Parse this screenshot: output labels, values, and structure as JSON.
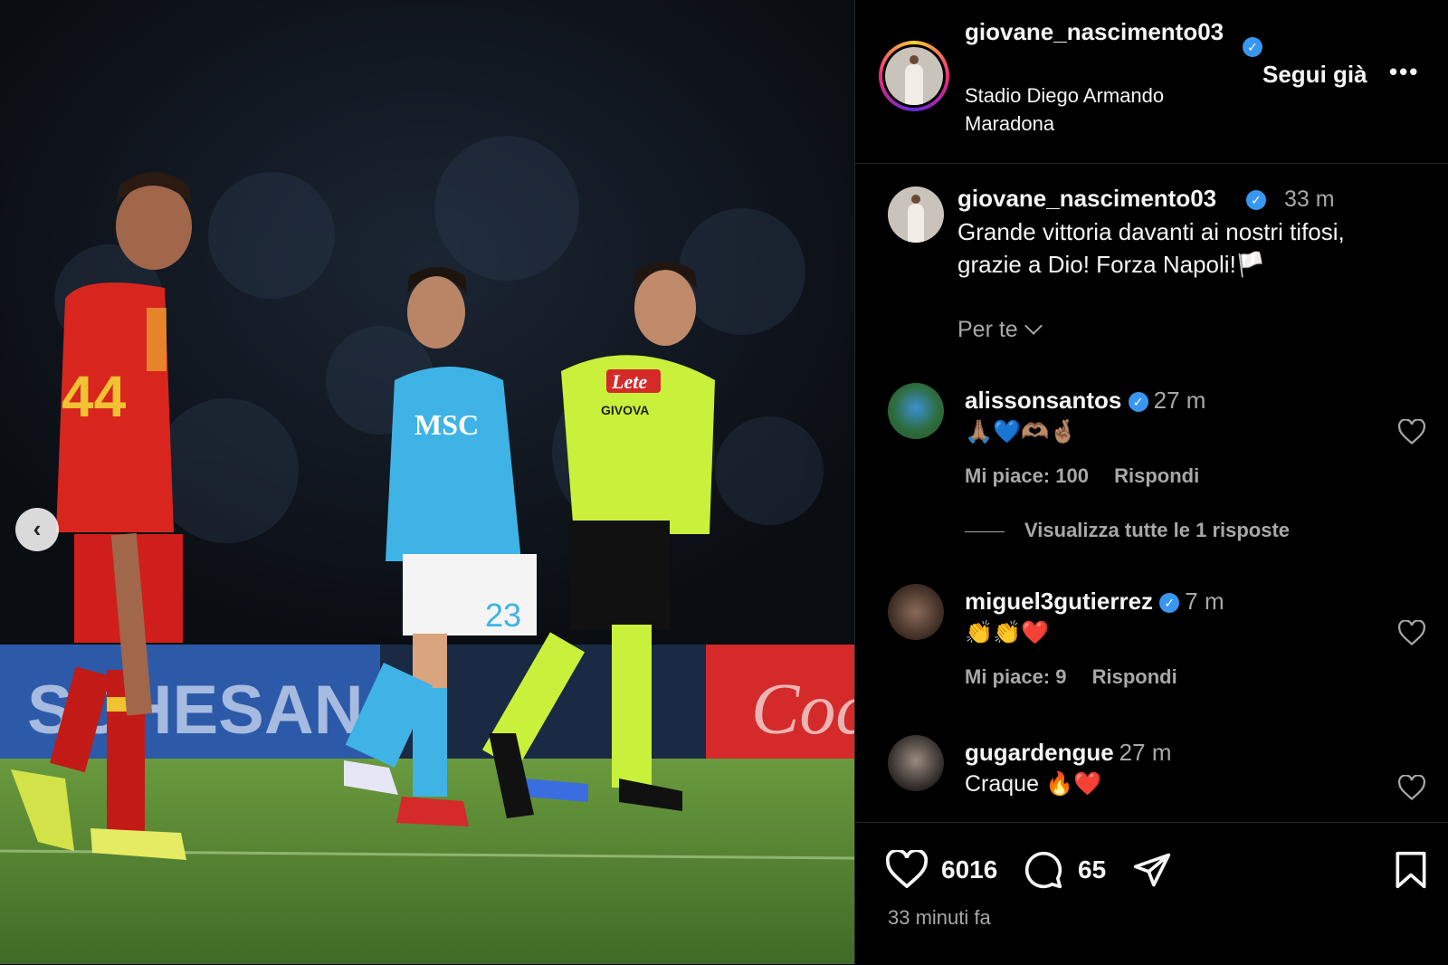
{
  "post": {
    "username": "giovane_nascimento03",
    "username_wrapped": "giovane_nascimento03",
    "location": "Stadio Diego Armando Maradona",
    "follow_label": "Segui già",
    "more_label": "•••",
    "verified_glyph": "✓"
  },
  "photo": {
    "prev_glyph": "‹",
    "banner_left": "SCHESANA",
    "banner_right": "Coca",
    "shirt_sponsor": "MSC",
    "ref_sponsor": "Lete",
    "ref_sponsor2": "GIVOVA",
    "number_red": "44",
    "number_blue": "23"
  },
  "caption": {
    "username": "giovane_nascimento03",
    "time": "33 m",
    "text": "Grande vittoria davanti ai nostri tifosi, grazie a Dio! Forza Napoli!",
    "flag_emoji": "🏳️",
    "per_te": "Per te"
  },
  "comments": [
    {
      "username": "alissonsantos",
      "verified": true,
      "time": "27 m",
      "text": "🙏🏽💙🫶🏽🤞🏽",
      "likes": "Mi piace: 100",
      "reply": "Rispondi",
      "view_replies": "Visualizza tutte le 1 risposte"
    },
    {
      "username": "miguel3gutierrez",
      "verified": true,
      "time": "7 m",
      "text": "👏👏❤️",
      "likes": "Mi piace: 9",
      "reply": "Rispondi"
    },
    {
      "username": "gugardengue",
      "verified": false,
      "time": "27 m",
      "text": "Craque 🔥❤️"
    }
  ],
  "actions": {
    "likes_count": "6016",
    "comments_count": "65",
    "posted": "33 minuti fa"
  },
  "colors": {
    "verified": "#3897f0",
    "muted": "#a8a8a8",
    "napoli_blue": "#3fb3e6",
    "referee_yellow": "#c9f03a",
    "lecce_red": "#d8261f"
  }
}
